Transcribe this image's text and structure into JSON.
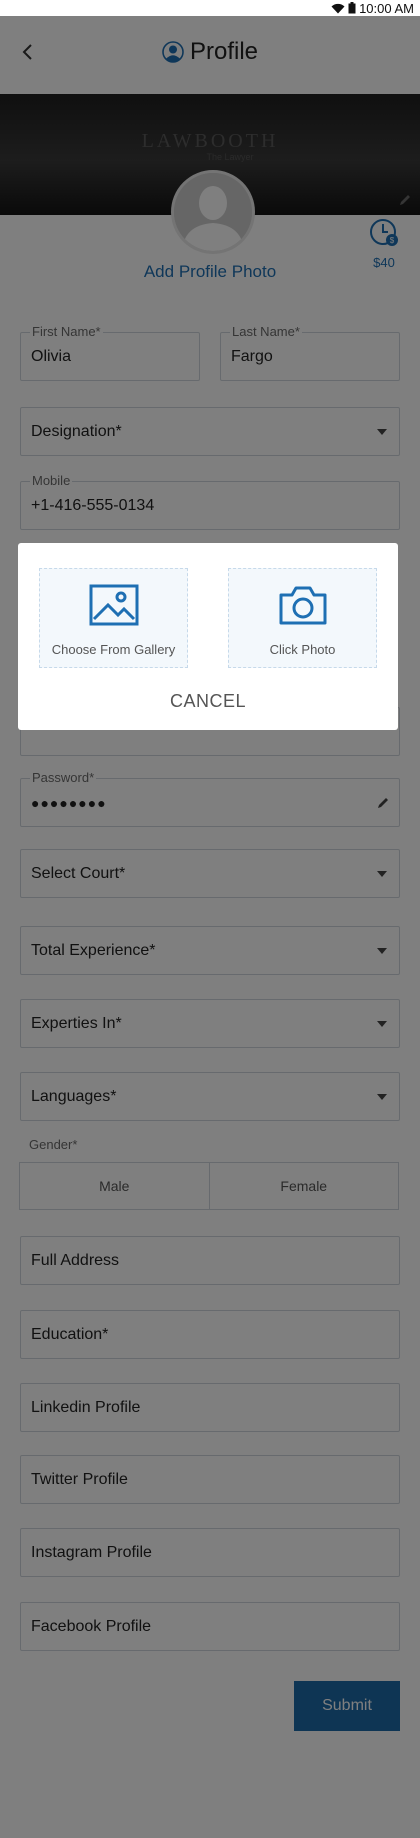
{
  "status_bar": {
    "time": "10:00 AM",
    "wifi_icon": "wifi-icon",
    "battery_icon": "battery-icon"
  },
  "header": {
    "title": "Profile",
    "back_icon": "chevron-left-icon",
    "profile_icon": "user-circle-icon"
  },
  "banner": {
    "logo_text": "LAWBOOTH",
    "tagline": "The Lawyer"
  },
  "profile": {
    "add_photo_label": "Add Profile Photo",
    "credit_amount": "$40",
    "credit_icon": "clock-badge-icon"
  },
  "form": {
    "first_name": {
      "label": "First Name*",
      "value": "Olivia"
    },
    "last_name": {
      "label": "Last Name*",
      "value": "Fargo"
    },
    "designation": {
      "placeholder": "Designation*"
    },
    "mobile": {
      "label": "Mobile",
      "value": "+1-416-555-0134"
    },
    "password": {
      "label": "Password*",
      "value": "●●●●●●●●"
    },
    "select_court": {
      "placeholder": "Select Court*"
    },
    "total_experience": {
      "placeholder": "Total Experience*"
    },
    "experties_in": {
      "placeholder": "Experties In*"
    },
    "languages": {
      "placeholder": "Languages*"
    },
    "gender": {
      "label": "Gender*",
      "options": [
        "Male",
        "Female"
      ]
    },
    "full_address": {
      "placeholder": "Full Address"
    },
    "education": {
      "placeholder": "Education*"
    },
    "linkedin": {
      "placeholder": "Linkedin Profile"
    },
    "twitter": {
      "placeholder": "Twitter Profile"
    },
    "instagram": {
      "placeholder": "Instagram Profile"
    },
    "facebook": {
      "placeholder": "Facebook Profile"
    },
    "submit_label": "Submit"
  },
  "dialog": {
    "gallery_label": "Choose From Gallery",
    "camera_label": "Click Photo",
    "cancel_label": "CANCEL",
    "accent_color": "#1e6fb3"
  },
  "colors": {
    "primary": "#1d6aa8",
    "link": "#1e6fb3",
    "overlay": "rgba(0,0,0,0.5)"
  }
}
